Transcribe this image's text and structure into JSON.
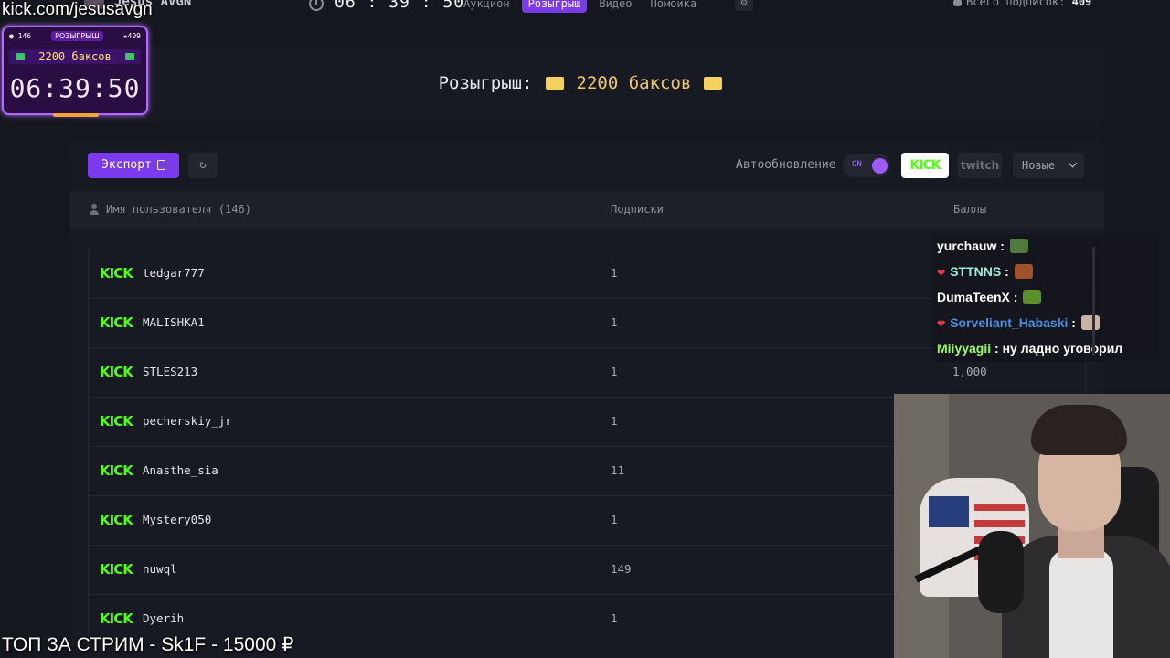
{
  "overlay": {
    "kick_url": "kick.com/jesusavgn",
    "bottom_banner": "ТОП ЗА СТРИМ - Sk1F - 15000 ₽"
  },
  "topbar": {
    "channel_name": "Jesus AVGN",
    "timer": "06 : 39 : 50",
    "tabs": [
      {
        "label": "Аукцион",
        "active": false
      },
      {
        "label": "Розыгрыш",
        "active": true
      },
      {
        "label": "Видео",
        "active": false
      },
      {
        "label": "Помойка",
        "active": false
      }
    ],
    "subs_total_label": "Всего подписок:",
    "subs_total_value": "409"
  },
  "widget": {
    "participants": "146",
    "tag": "РОЗЫГРЫШ",
    "subs": "409",
    "prize": "2200 баксов",
    "timer": "06:39:50"
  },
  "giveaway": {
    "title_prefix": "Розыгрыш:",
    "prize": "2200 баксов"
  },
  "toolbar": {
    "export_label": "Экспорт",
    "refresh_icon": "↻",
    "autoupdate_label": "Автообновление",
    "toggle_state": "ON",
    "kick_label": "KICK",
    "twitch_label": "twitch",
    "sort_value": "Новые"
  },
  "table": {
    "col_user": "Имя пользователя (146)",
    "col_subs": "Подписки",
    "col_points": "Баллы",
    "rows": [
      {
        "platform": "KICK",
        "user": "tedgar777",
        "subs": "1",
        "points": ""
      },
      {
        "platform": "KICK",
        "user": "MALISHKA1",
        "subs": "1",
        "points": ""
      },
      {
        "platform": "KICK",
        "user": "STLES213",
        "subs": "1",
        "points": "1,000"
      },
      {
        "platform": "KICK",
        "user": "pecherskiy_jr",
        "subs": "1",
        "points": ""
      },
      {
        "platform": "KICK",
        "user": "Anasthe_sia",
        "subs": "11",
        "points": ""
      },
      {
        "platform": "KICK",
        "user": "Mystery050",
        "subs": "1",
        "points": ""
      },
      {
        "platform": "KICK",
        "user": "nuwql",
        "subs": "149",
        "points": ""
      },
      {
        "platform": "KICK",
        "user": "Dyerih",
        "subs": "1",
        "points": ""
      }
    ]
  },
  "chat": {
    "messages": [
      {
        "user": "yurchauw",
        "color": "#ffffff",
        "badge": false,
        "text": ""
      },
      {
        "user": "STTNNS",
        "color": "#9ef0d8",
        "badge": true,
        "text": ""
      },
      {
        "user": "DumaTeenX",
        "color": "#ffffff",
        "badge": false,
        "text": ""
      },
      {
        "user": "Sorveliant_Habaski",
        "color": "#4e8fe0",
        "badge": true,
        "text": ""
      },
      {
        "user": "Miiyyagii",
        "color": "#9dfc5a",
        "badge": false,
        "text": "ну ладно уговорил"
      }
    ]
  },
  "colors": {
    "accent": "#7c3aed",
    "kick_green": "#53fc18",
    "background": "#15171f"
  }
}
